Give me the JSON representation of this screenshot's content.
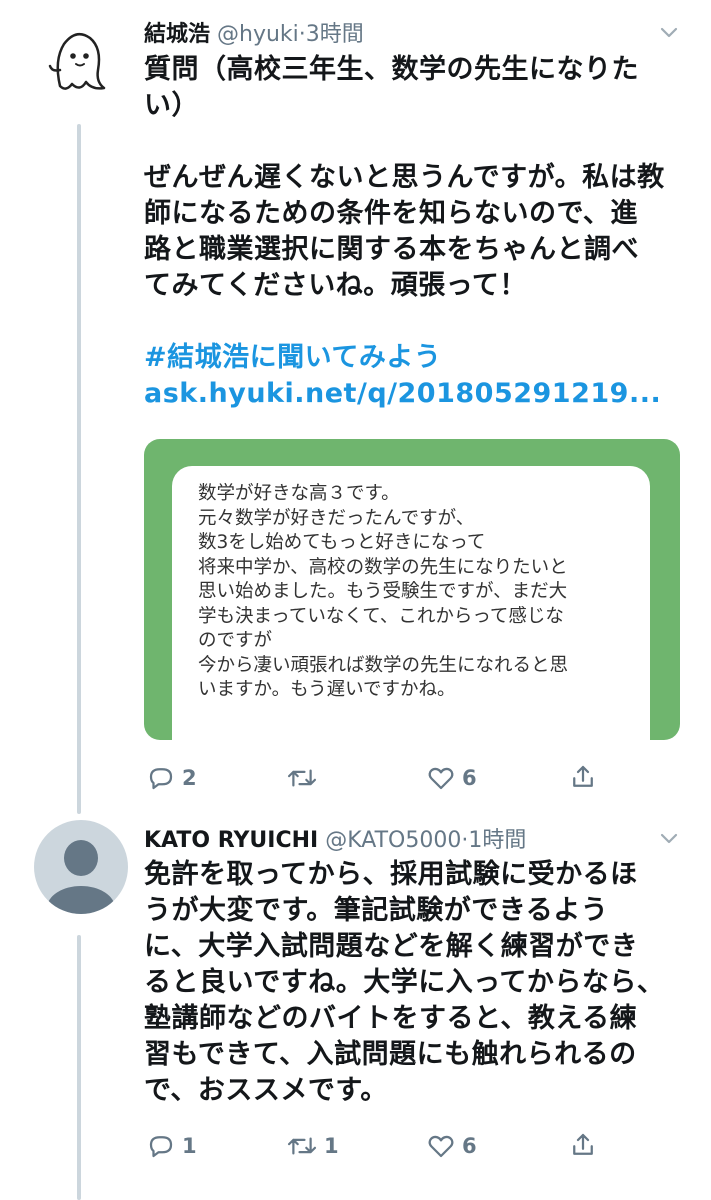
{
  "tweet1": {
    "name": "結城浩",
    "handle": "@hyuki",
    "time": "3時間",
    "question_line1": "質問（高校三年生、数学の先生になりた",
    "question_line2": "い）",
    "answer_lines": [
      "ぜんぜん遅くないと思うんですが。私は教",
      "師になるための条件を知らないので、進",
      "路と職業選択に関する本をちゃんと調べ",
      "てみてくださいね。頑張って！"
    ],
    "hashtag": "#結城浩に聞いてみよう",
    "url": "ask.hyuki.net/q/201805291219...",
    "card_lines": [
      "数学が好きな高３です。",
      "元々数学が好きだったんですが、",
      "数3をし始めてもっと好きになって",
      "将来中学か、高校の数学の先生になりたいと",
      "思い始めました。もう受験生ですが、まだ大",
      "学も決まっていなくて、これからって感じな",
      "のですが",
      "今から凄い頑張れば数学の先生になれると思",
      "いますか。もう遅いですかね。"
    ],
    "replies": "2",
    "retweets": "",
    "likes": "6"
  },
  "tweet2": {
    "name": "KATO RYUICHI",
    "handle": "@KATO5000",
    "time": "1時間",
    "lines": [
      "免許を取ってから、採用試験に受かるほ",
      "うが大変です。筆記試験ができるよう",
      "に、大学入試問題などを解く練習ができ",
      "ると良いですね。大学に入ってからなら、",
      "塾講師などのバイトをすると、教える練",
      "習もできて、入試問題にも触れられるの",
      "で、おススメです。"
    ],
    "replies": "1",
    "retweets": "1",
    "likes": "6"
  },
  "colors": {
    "link": "#1b95e0",
    "card_bg": "#6fb56e",
    "thread_line": "#ccd6dd"
  },
  "icons": [
    "ghost-avatar",
    "default-avatar",
    "chevron-down-icon",
    "reply-icon",
    "retweet-icon",
    "like-icon",
    "share-icon"
  ]
}
